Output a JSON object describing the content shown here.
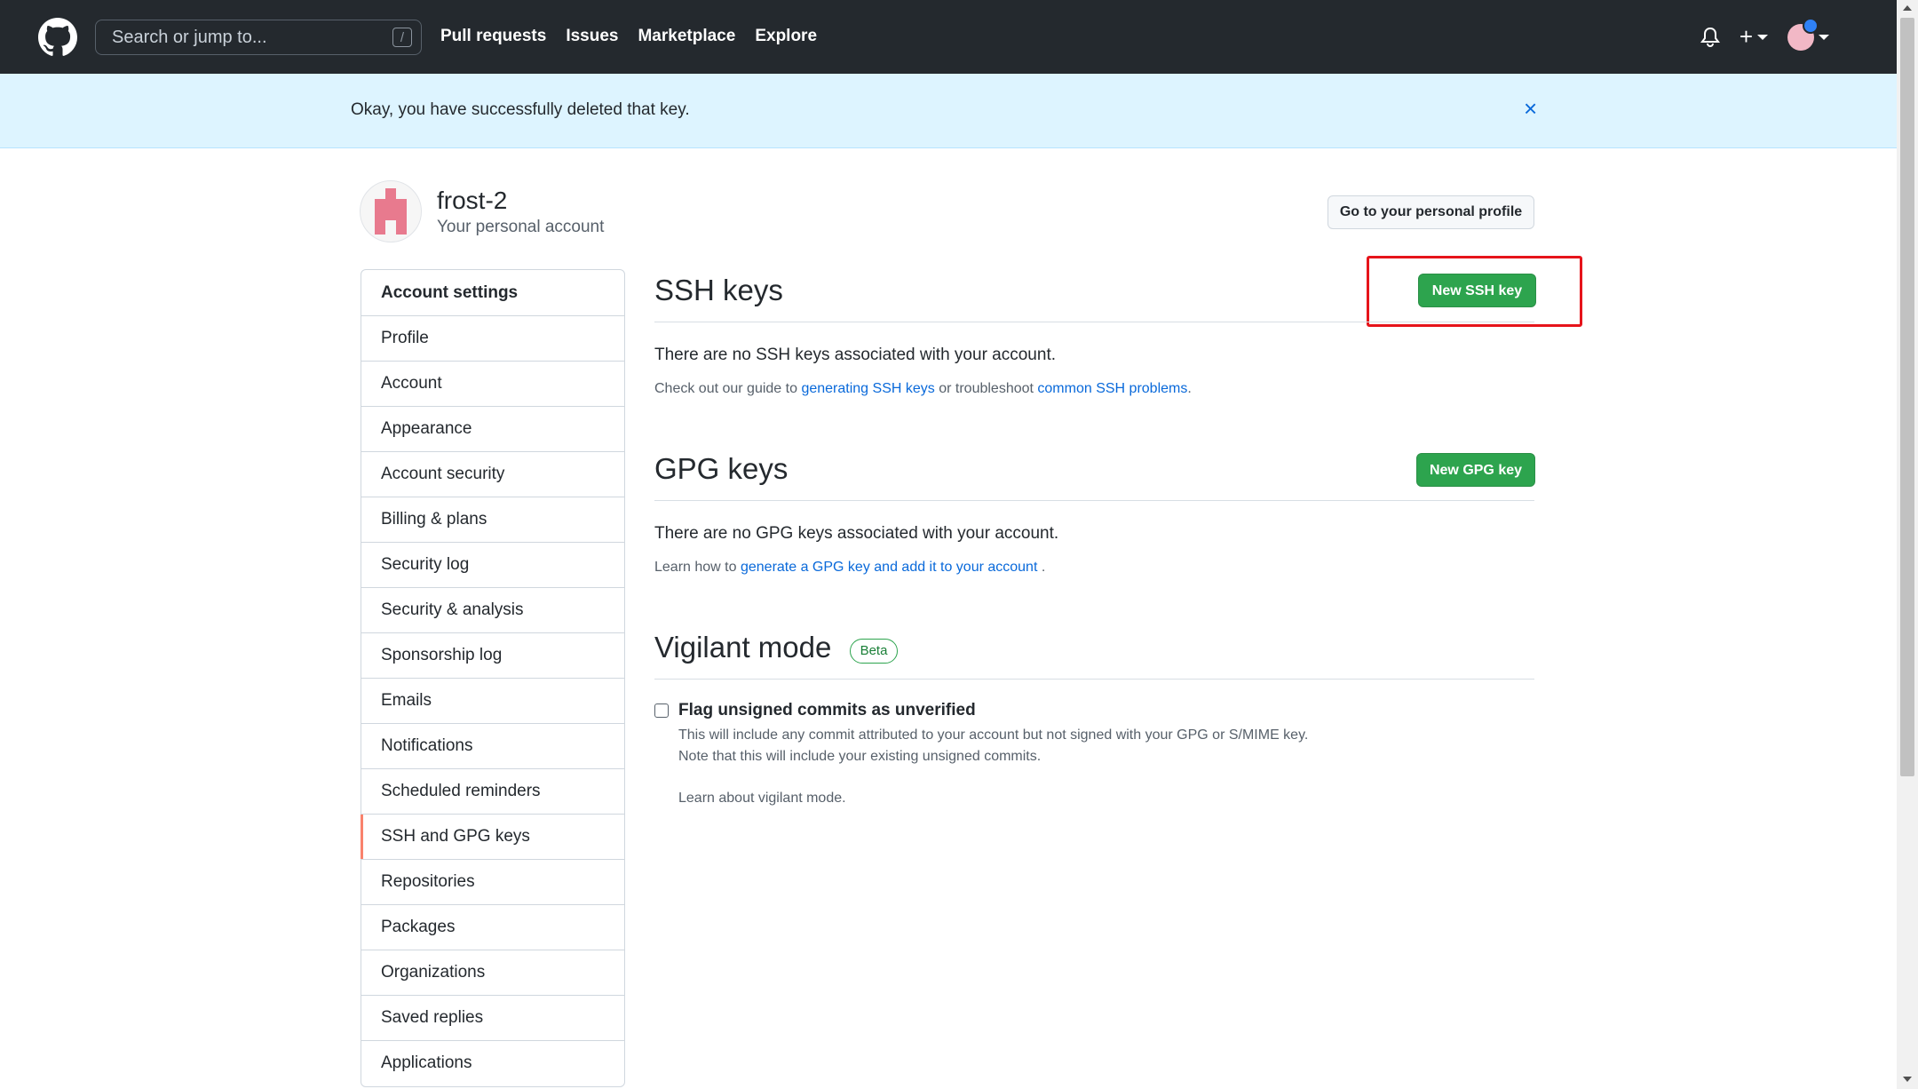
{
  "header": {
    "search_placeholder": "Search or jump to...",
    "search_key": "/",
    "nav": [
      "Pull requests",
      "Issues",
      "Marketplace",
      "Explore"
    ],
    "plus": "+"
  },
  "flash": {
    "message": "Okay, you have successfully deleted that key.",
    "close": "×"
  },
  "profile": {
    "username": "frost-2",
    "subtitle": "Your personal account",
    "profile_button": "Go to your personal profile"
  },
  "sidebar": {
    "heading": "Account settings",
    "items": [
      {
        "label": "Profile"
      },
      {
        "label": "Account"
      },
      {
        "label": "Appearance"
      },
      {
        "label": "Account security"
      },
      {
        "label": "Billing & plans"
      },
      {
        "label": "Security log"
      },
      {
        "label": "Security & analysis"
      },
      {
        "label": "Sponsorship log"
      },
      {
        "label": "Emails"
      },
      {
        "label": "Notifications"
      },
      {
        "label": "Scheduled reminders"
      },
      {
        "label": "SSH and GPG keys"
      },
      {
        "label": "Repositories"
      },
      {
        "label": "Packages"
      },
      {
        "label": "Organizations"
      },
      {
        "label": "Saved replies"
      },
      {
        "label": "Applications"
      }
    ],
    "active_item": "SSH and GPG keys"
  },
  "ssh": {
    "title": "SSH keys",
    "button": "New SSH key",
    "empty": "There are no SSH keys associated with your account.",
    "guide_prefix": "Check out our guide to",
    "guide_link1": "generating SSH keys",
    "guide_middle": "or troubleshoot",
    "guide_link2": "common SSH problems",
    "guide_suffix": "."
  },
  "gpg": {
    "title": "GPG keys",
    "button": "New GPG key",
    "empty": "There are no GPG keys associated with your account.",
    "learn_prefix": "Learn how to",
    "learn_link": "generate a GPG key and add it to your account",
    "learn_suffix": "."
  },
  "vigilant": {
    "title": "Vigilant mode",
    "badge": "Beta",
    "checkbox_label": "Flag unsigned commits as unverified",
    "checked": false,
    "note1": "This will include any commit attributed to your account but not signed with your GPG or S/MIME key.",
    "note2": "Note that this will include your existing unsigned commits.",
    "learn_link": "Learn about vigilant mode."
  },
  "colors": {
    "header_bg": "#24292e",
    "flash_bg": "#ddf4ff",
    "primary_button": "#2da44e",
    "link": "#0969da",
    "active_indicator": "#f9826c",
    "annotation": "#e6141b"
  }
}
